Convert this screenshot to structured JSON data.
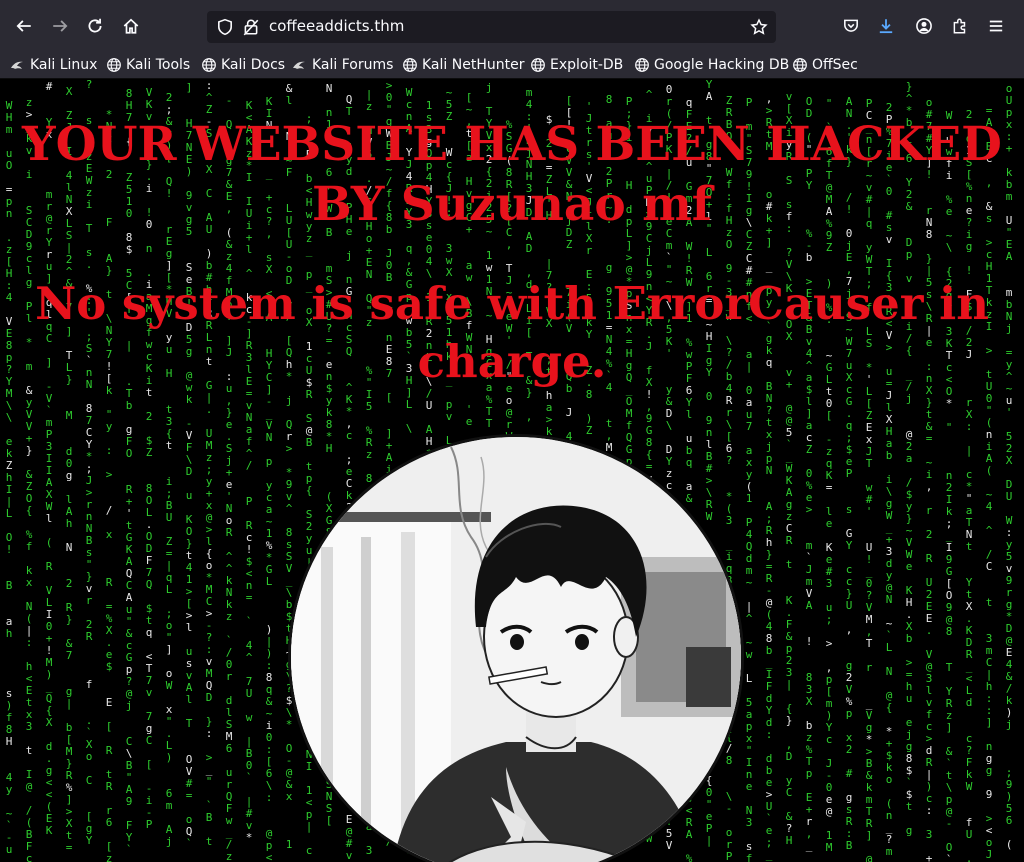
{
  "browser": {
    "url": "coffeeaddicts.thm",
    "nav": {
      "back_icon": "arrow-left-icon",
      "forward_icon": "arrow-right-icon",
      "reload_icon": "reload-icon",
      "home_icon": "home-icon"
    },
    "bookmarks": [
      {
        "label": "Kali Linux",
        "icon": "kali-dragon-icon"
      },
      {
        "label": "Kali Tools",
        "icon": "globe-icon"
      },
      {
        "label": "Kali Docs",
        "icon": "globe-icon"
      },
      {
        "label": "Kali Forums",
        "icon": "kali-dragon-icon"
      },
      {
        "label": "Kali NetHunter",
        "icon": "globe-icon"
      },
      {
        "label": "Exploit-DB",
        "icon": "globe-icon"
      },
      {
        "label": "Google Hacking DB",
        "icon": "globe-icon"
      },
      {
        "label": "OffSec",
        "icon": "globe-icon"
      }
    ]
  },
  "page": {
    "headline_1": "YOUR WEBSITE HAS BEEN HACKED BY Suzunao mf",
    "headline_2": "No system is safe with ErrorCauser in charge.",
    "colors": {
      "headline": "#e8121c",
      "matrix": "#2ecc2e",
      "background": "#000000"
    },
    "image": "anime-character-smoking-avatar"
  }
}
